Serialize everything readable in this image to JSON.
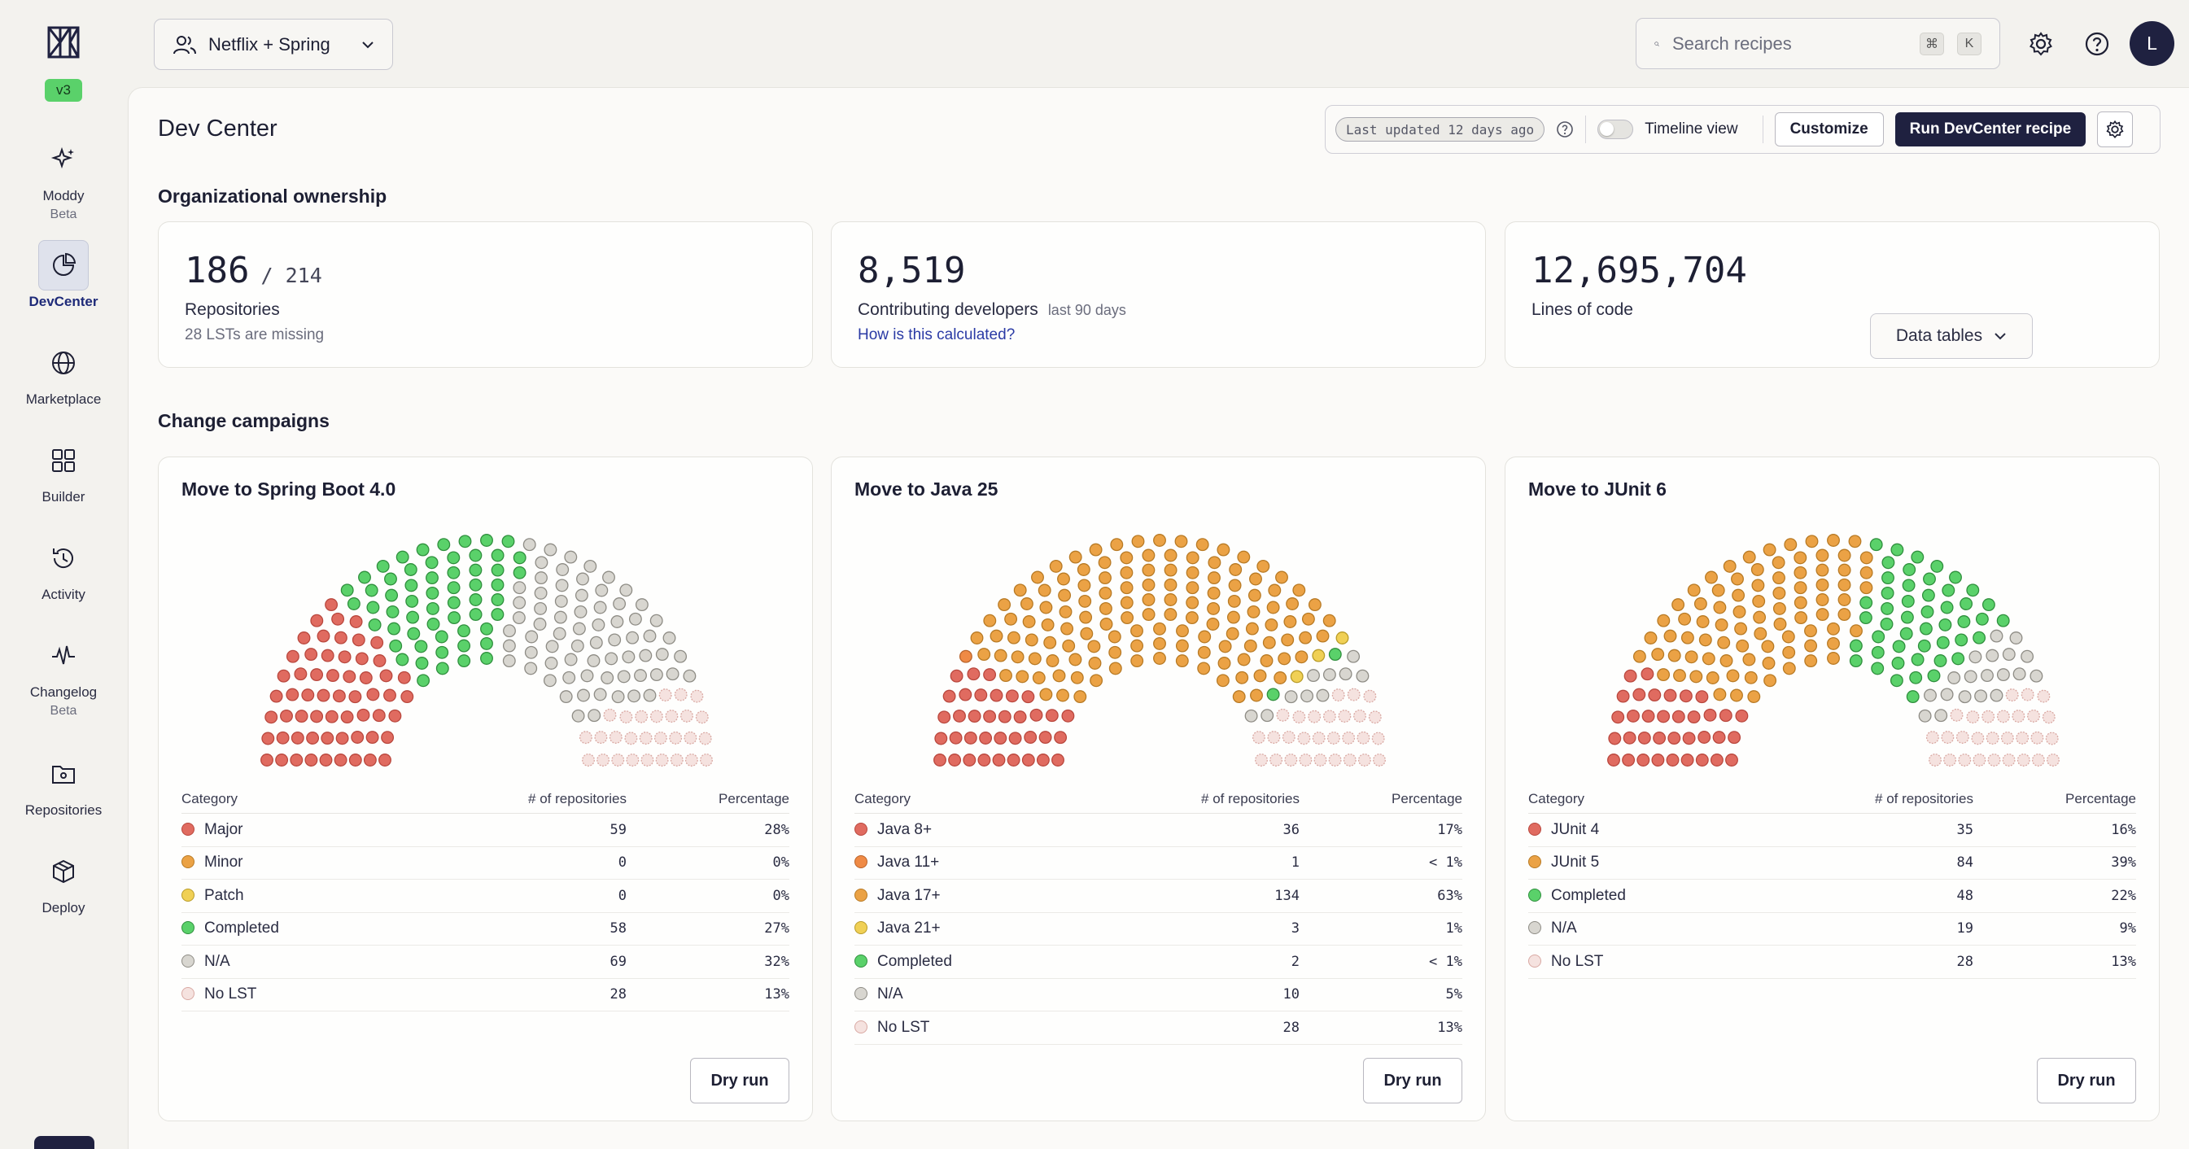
{
  "app": {
    "version": "v3"
  },
  "nav": [
    {
      "id": "moddy",
      "label": "Moddy",
      "sub": "Beta",
      "icon": "sparkle-icon"
    },
    {
      "id": "devcenter",
      "label": "DevCenter",
      "sub": "",
      "icon": "pie-chart-icon",
      "active": true
    },
    {
      "id": "marketplace",
      "label": "Marketplace",
      "sub": "",
      "icon": "globe-icon"
    },
    {
      "id": "builder",
      "label": "Builder",
      "sub": "",
      "icon": "grid-icon"
    },
    {
      "id": "activity",
      "label": "Activity",
      "sub": "",
      "icon": "history-icon"
    },
    {
      "id": "changelog",
      "label": "Changelog",
      "sub": "Beta",
      "icon": "pulse-icon"
    },
    {
      "id": "repositories",
      "label": "Repositories",
      "sub": "",
      "icon": "folder-icon"
    },
    {
      "id": "deploy",
      "label": "Deploy",
      "sub": "",
      "icon": "package-icon"
    }
  ],
  "topbar": {
    "org": "Netflix + Spring",
    "search_placeholder": "Search recipes",
    "shortcut_1": "⌘",
    "shortcut_2": "K",
    "avatar": "L"
  },
  "page": {
    "title": "Dev Center",
    "last_updated": "Last updated 12 days ago",
    "timeline_label": "Timeline view",
    "customize": "Customize",
    "run": "Run DevCenter recipe"
  },
  "ownership": {
    "title": "Organizational ownership",
    "repos": {
      "value": "186",
      "total": "/ 214",
      "label": "Repositories",
      "sub": "28 LSTs are missing"
    },
    "devs": {
      "value": "8,519",
      "label": "Contributing developers",
      "period": "last 90 days",
      "link": "How is this calculated?"
    },
    "loc": {
      "value": "12,695,704",
      "label": "Lines of code"
    }
  },
  "campaigns_section": {
    "title": "Change campaigns",
    "data_tables": "Data tables"
  },
  "table_headers": {
    "category": "Category",
    "repos": "# of repositories",
    "percentage": "Percentage"
  },
  "dry_run": "Dry run",
  "colors": {
    "major": "#e06b60",
    "minor": "#eba245",
    "patch": "#f0d055",
    "completed": "#5ad16a",
    "na": "#d8d6d0",
    "nolst": "#f5e2df"
  },
  "campaigns": [
    {
      "title": "Move to Spring Boot 4.0",
      "rows": [
        {
          "name": "Major",
          "count": "59",
          "pct": "28%",
          "color": "#e06b60",
          "border": "#b9473d"
        },
        {
          "name": "Minor",
          "count": "0",
          "pct": "0%",
          "color": "#eba245",
          "border": "#b87a24"
        },
        {
          "name": "Patch",
          "count": "0",
          "pct": "0%",
          "color": "#f0d055",
          "border": "#b99c28"
        },
        {
          "name": "Completed",
          "count": "58",
          "pct": "27%",
          "color": "#5ad16a",
          "border": "#2f8f3d"
        },
        {
          "name": "N/A",
          "count": "69",
          "pct": "32%",
          "color": "#d8d6d0",
          "border": "#8e8c85"
        },
        {
          "name": "No LST",
          "count": "28",
          "pct": "13%",
          "color": "#f5e2df",
          "border": "#d9a9a3"
        }
      ]
    },
    {
      "title": "Move to Java 25",
      "rows": [
        {
          "name": "Java 8+",
          "count": "36",
          "pct": "17%",
          "color": "#e06b60",
          "border": "#b9473d"
        },
        {
          "name": "Java 11+",
          "count": "1",
          "pct": "< 1%",
          "color": "#ef8a45",
          "border": "#b9632a"
        },
        {
          "name": "Java 17+",
          "count": "134",
          "pct": "63%",
          "color": "#eba245",
          "border": "#b87a24"
        },
        {
          "name": "Java 21+",
          "count": "3",
          "pct": "1%",
          "color": "#f0d055",
          "border": "#b99c28"
        },
        {
          "name": "Completed",
          "count": "2",
          "pct": "< 1%",
          "color": "#5ad16a",
          "border": "#2f8f3d"
        },
        {
          "name": "N/A",
          "count": "10",
          "pct": "5%",
          "color": "#d8d6d0",
          "border": "#8e8c85"
        },
        {
          "name": "No LST",
          "count": "28",
          "pct": "13%",
          "color": "#f5e2df",
          "border": "#d9a9a3"
        }
      ]
    },
    {
      "title": "Move to JUnit 6",
      "rows": [
        {
          "name": "JUnit 4",
          "count": "35",
          "pct": "16%",
          "color": "#e06b60",
          "border": "#b9473d"
        },
        {
          "name": "JUnit 5",
          "count": "84",
          "pct": "39%",
          "color": "#eba245",
          "border": "#b87a24"
        },
        {
          "name": "Completed",
          "count": "48",
          "pct": "22%",
          "color": "#5ad16a",
          "border": "#2f8f3d"
        },
        {
          "name": "N/A",
          "count": "19",
          "pct": "9%",
          "color": "#d8d6d0",
          "border": "#8e8c85"
        },
        {
          "name": "No LST",
          "count": "28",
          "pct": "13%",
          "color": "#f5e2df",
          "border": "#d9a9a3"
        }
      ]
    }
  ]
}
